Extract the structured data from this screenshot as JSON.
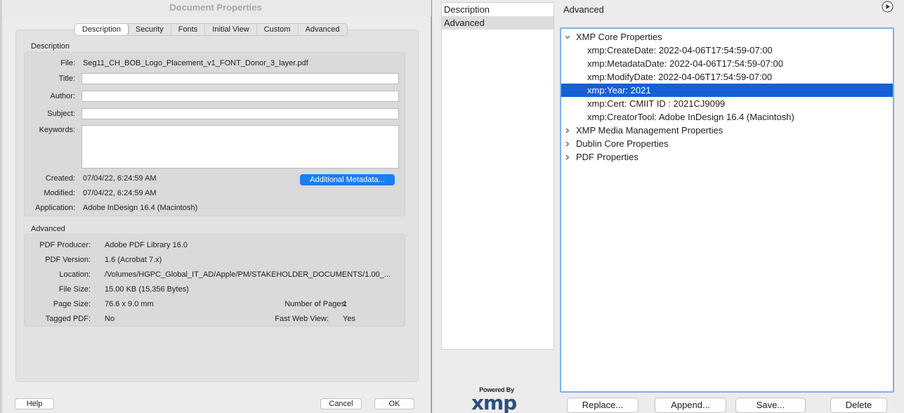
{
  "left_dialog": {
    "title": "Document Properties",
    "tabs": [
      {
        "label": "Description",
        "active": true
      },
      {
        "label": "Security",
        "active": false
      },
      {
        "label": "Fonts",
        "active": false
      },
      {
        "label": "Initial View",
        "active": false
      },
      {
        "label": "Custom",
        "active": false
      },
      {
        "label": "Advanced",
        "active": false
      }
    ],
    "description": {
      "heading": "Description",
      "file_label": "File:",
      "file_value": "Seg11_CH_BOB_Logo_Placement_v1_FONT_Donor_3_layer.pdf",
      "title_label": "Title:",
      "title_value": "",
      "author_label": "Author:",
      "author_value": "",
      "subject_label": "Subject:",
      "subject_value": "",
      "keywords_label": "Keywords:",
      "keywords_value": "",
      "created_label": "Created:",
      "created_value": "07/04/22, 6:24:59 AM",
      "modified_label": "Modified:",
      "modified_value": "07/04/22, 6:24:59 AM",
      "application_label": "Application:",
      "application_value": "Adobe InDesign 16.4 (Macintosh)",
      "metadata_button": "Additional Metadata..."
    },
    "advanced": {
      "heading": "Advanced",
      "producer_label": "PDF Producer:",
      "producer_value": "Adobe PDF Library 16.0",
      "version_label": "PDF Version:",
      "version_value": "1.6 (Acrobat 7.x)",
      "location_label": "Location:",
      "location_value": "/Volumes/HGPC_Global_IT_AD/Apple/PM/STAKEHOLDER_DOCUMENTS/1.00_...",
      "filesize_label": "File Size:",
      "filesize_value": "15.00 KB (15,356 Bytes)",
      "pagesize_label": "Page Size:",
      "pagesize_value": "76.6 x 9.0 mm",
      "pages_label": "Number of Pages:",
      "pages_value": "1",
      "tagged_label": "Tagged PDF:",
      "tagged_value": "No",
      "fastweb_label": "Fast Web View:",
      "fastweb_value": "Yes"
    },
    "buttons": {
      "help": "Help",
      "cancel": "Cancel",
      "ok": "OK"
    }
  },
  "right_dialog": {
    "nav": [
      {
        "label": "Description",
        "selected": false
      },
      {
        "label": "Advanced",
        "selected": true
      }
    ],
    "panel_title": "Advanced",
    "tree": {
      "xmp_core": {
        "label": "XMP Core Properties",
        "children": [
          "xmp:CreateDate: 2022-04-06T17:54:59-07:00",
          "xmp:MetadataDate: 2022-04-06T17:54:59-07:00",
          "xmp:ModifyDate: 2022-04-06T17:54:59-07:00",
          "xmp:Year: 2021",
          "xmp:Cert: CMIIT ID : 2021CJ9099",
          "xmp:CreatorTool: Adobe InDesign 16.4 (Macintosh)"
        ]
      },
      "collapsed": [
        "XMP Media Management Properties",
        "Dublin Core Properties",
        "PDF Properties"
      ]
    },
    "logo": {
      "powered_by": "Powered By",
      "wordmark": "xmp"
    },
    "buttons": {
      "replace": "Replace...",
      "append": "Append...",
      "save": "Save...",
      "delete": "Delete"
    },
    "colors": {
      "selection": "#1560d4",
      "focus_ring": "#7eaef0",
      "accent_button": "#1a7ef2"
    }
  }
}
